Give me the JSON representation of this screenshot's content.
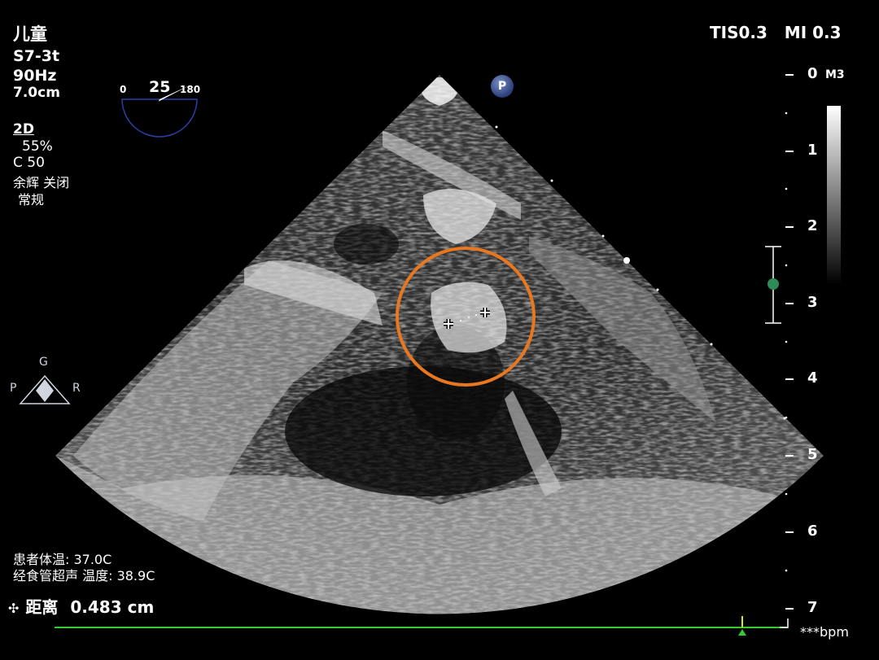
{
  "top_left": {
    "patient_type": "儿童",
    "probe": "S7-3t",
    "frame_rate": "90Hz",
    "depth": "7.0cm"
  },
  "mode": {
    "name": "2D",
    "gain": "55%",
    "compression": "C 50",
    "persistence": "余辉 关闭",
    "processing": "常规"
  },
  "top_right": {
    "indices": "TIS0.3   MI 0.3",
    "map": "M3"
  },
  "angle": {
    "min": "0",
    "value": "25",
    "max": "180",
    "fraction": 0.139
  },
  "probe_badge": "P",
  "orientation": {
    "top": "G",
    "left": "P",
    "right": "R"
  },
  "depth_scale": [
    "0",
    "1",
    "2",
    "3",
    "4",
    "5",
    "6",
    "7"
  ],
  "temperatures": {
    "patient": "患者体温: 37.0C",
    "probe": "经食管超声 温度: 38.9C"
  },
  "measurement": {
    "marker": "✣",
    "label": "距离",
    "value": "0.483 cm"
  },
  "ecg": {
    "heart_rate": "***bpm"
  },
  "colors": {
    "annotation_circle": "#e87722",
    "ecg_trace": "#33cc33",
    "focus_marker": "#2e8b57",
    "probe_badge": "#3a4f8f"
  }
}
